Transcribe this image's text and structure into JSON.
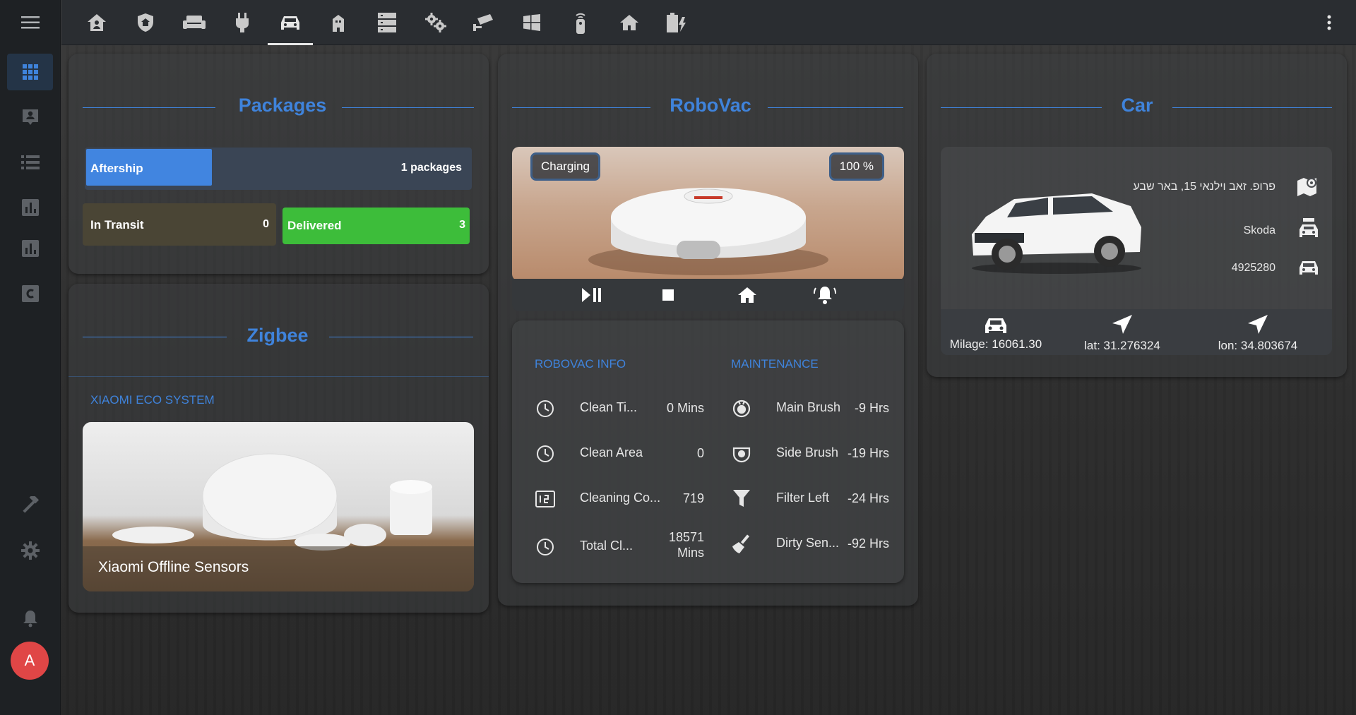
{
  "sidebar": {
    "items": [
      {
        "icon": "dashboard-grid-icon",
        "active": true
      },
      {
        "icon": "account-box-icon",
        "active": false
      },
      {
        "icon": "list-icon",
        "active": false
      },
      {
        "icon": "chart-bar-icon",
        "active": false
      },
      {
        "icon": "chart-bar-small-icon",
        "active": false
      },
      {
        "icon": "c-box-icon",
        "active": false
      }
    ],
    "bottom": [
      {
        "icon": "hammer-icon"
      },
      {
        "icon": "gear-icon"
      },
      {
        "icon": "bell-icon"
      }
    ],
    "avatar_initial": "A"
  },
  "topbar": {
    "tabs": [
      "home-account-icon",
      "shield-home-icon",
      "sofa-icon",
      "power-plug-icon",
      "car-icon",
      "city-icon",
      "server-icon",
      "cogs-icon",
      "cctv-icon",
      "windows-icon",
      "remote-icon",
      "home-icon",
      "battery-charging-icon"
    ],
    "active_tab": 4
  },
  "packages": {
    "title": "Packages",
    "aftership_label": "Aftership",
    "aftership_value": "1 packages",
    "in_transit_label": "In Transit",
    "in_transit_value": "0",
    "delivered_label": "Delivered",
    "delivered_value": "3"
  },
  "zigbee": {
    "title": "Zigbee",
    "subtitle": "XIAOMI ECO SYSTEM",
    "caption": "Xiaomi Offline Sensors"
  },
  "robovac": {
    "title": "RoboVac",
    "status": "Charging",
    "battery": "100 %",
    "info_heading": "ROBOVAC INFO",
    "maintenance_heading": "MAINTENANCE",
    "info": [
      {
        "icon": "clock-icon",
        "name": "Clean Ti...",
        "value": "0 Mins"
      },
      {
        "icon": "clock-icon",
        "name": "Clean Area",
        "value": "0"
      },
      {
        "icon": "counter-icon",
        "name": "Cleaning Co...",
        "value": "719"
      },
      {
        "icon": "clock-icon",
        "name": "Total Cl...",
        "value": "18571 Mins"
      }
    ],
    "maintenance": [
      {
        "icon": "robot-brush-icon",
        "name": "Main Brush",
        "value": "-9 Hrs"
      },
      {
        "icon": "side-brush-icon",
        "name": "Side Brush",
        "value": "-19 Hrs"
      },
      {
        "icon": "filter-icon",
        "name": "Filter Left",
        "value": "-24 Hrs"
      },
      {
        "icon": "broom-icon",
        "name": "Dirty Sen...",
        "value": "-92 Hrs"
      }
    ]
  },
  "car": {
    "title": "Car",
    "address": "פרופ. זאב וילנאי 15, באר שבע",
    "make": "Skoda",
    "plate": "4925280",
    "milage": "Milage: 16061.30",
    "lat": "lat: 31.276324",
    "lon": "lon: 34.803674"
  },
  "colors": {
    "accent": "#3f83db",
    "aftership_fill": "#4185e0",
    "delivered_fill": "#3dbd3a",
    "avatar": "#e04646",
    "in_transit_bg": "#4a4535",
    "package_bar_bg": "#3a4555"
  }
}
